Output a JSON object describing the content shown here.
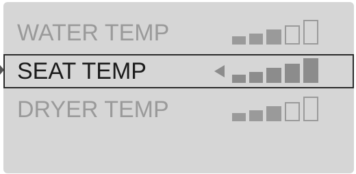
{
  "menu": {
    "items": [
      {
        "label": "WATER TEMP",
        "level": 3,
        "max_level": 5,
        "selected": false
      },
      {
        "label": "SEAT TEMP",
        "level": 5,
        "max_level": 5,
        "selected": true
      },
      {
        "label": "DRYER TEMP",
        "level": 3,
        "max_level": 5,
        "selected": false
      }
    ]
  },
  "colors": {
    "screen_bg": "#d6d6d6",
    "active_text": "#1a1a1a",
    "inactive_text": "#9a9a9a",
    "bar": "#9a9a9a",
    "selection_border": "#2a2a2a"
  },
  "icons": {
    "selection_arrow": "triangle-left-icon",
    "external_pointer": "triangle-right-icon"
  }
}
